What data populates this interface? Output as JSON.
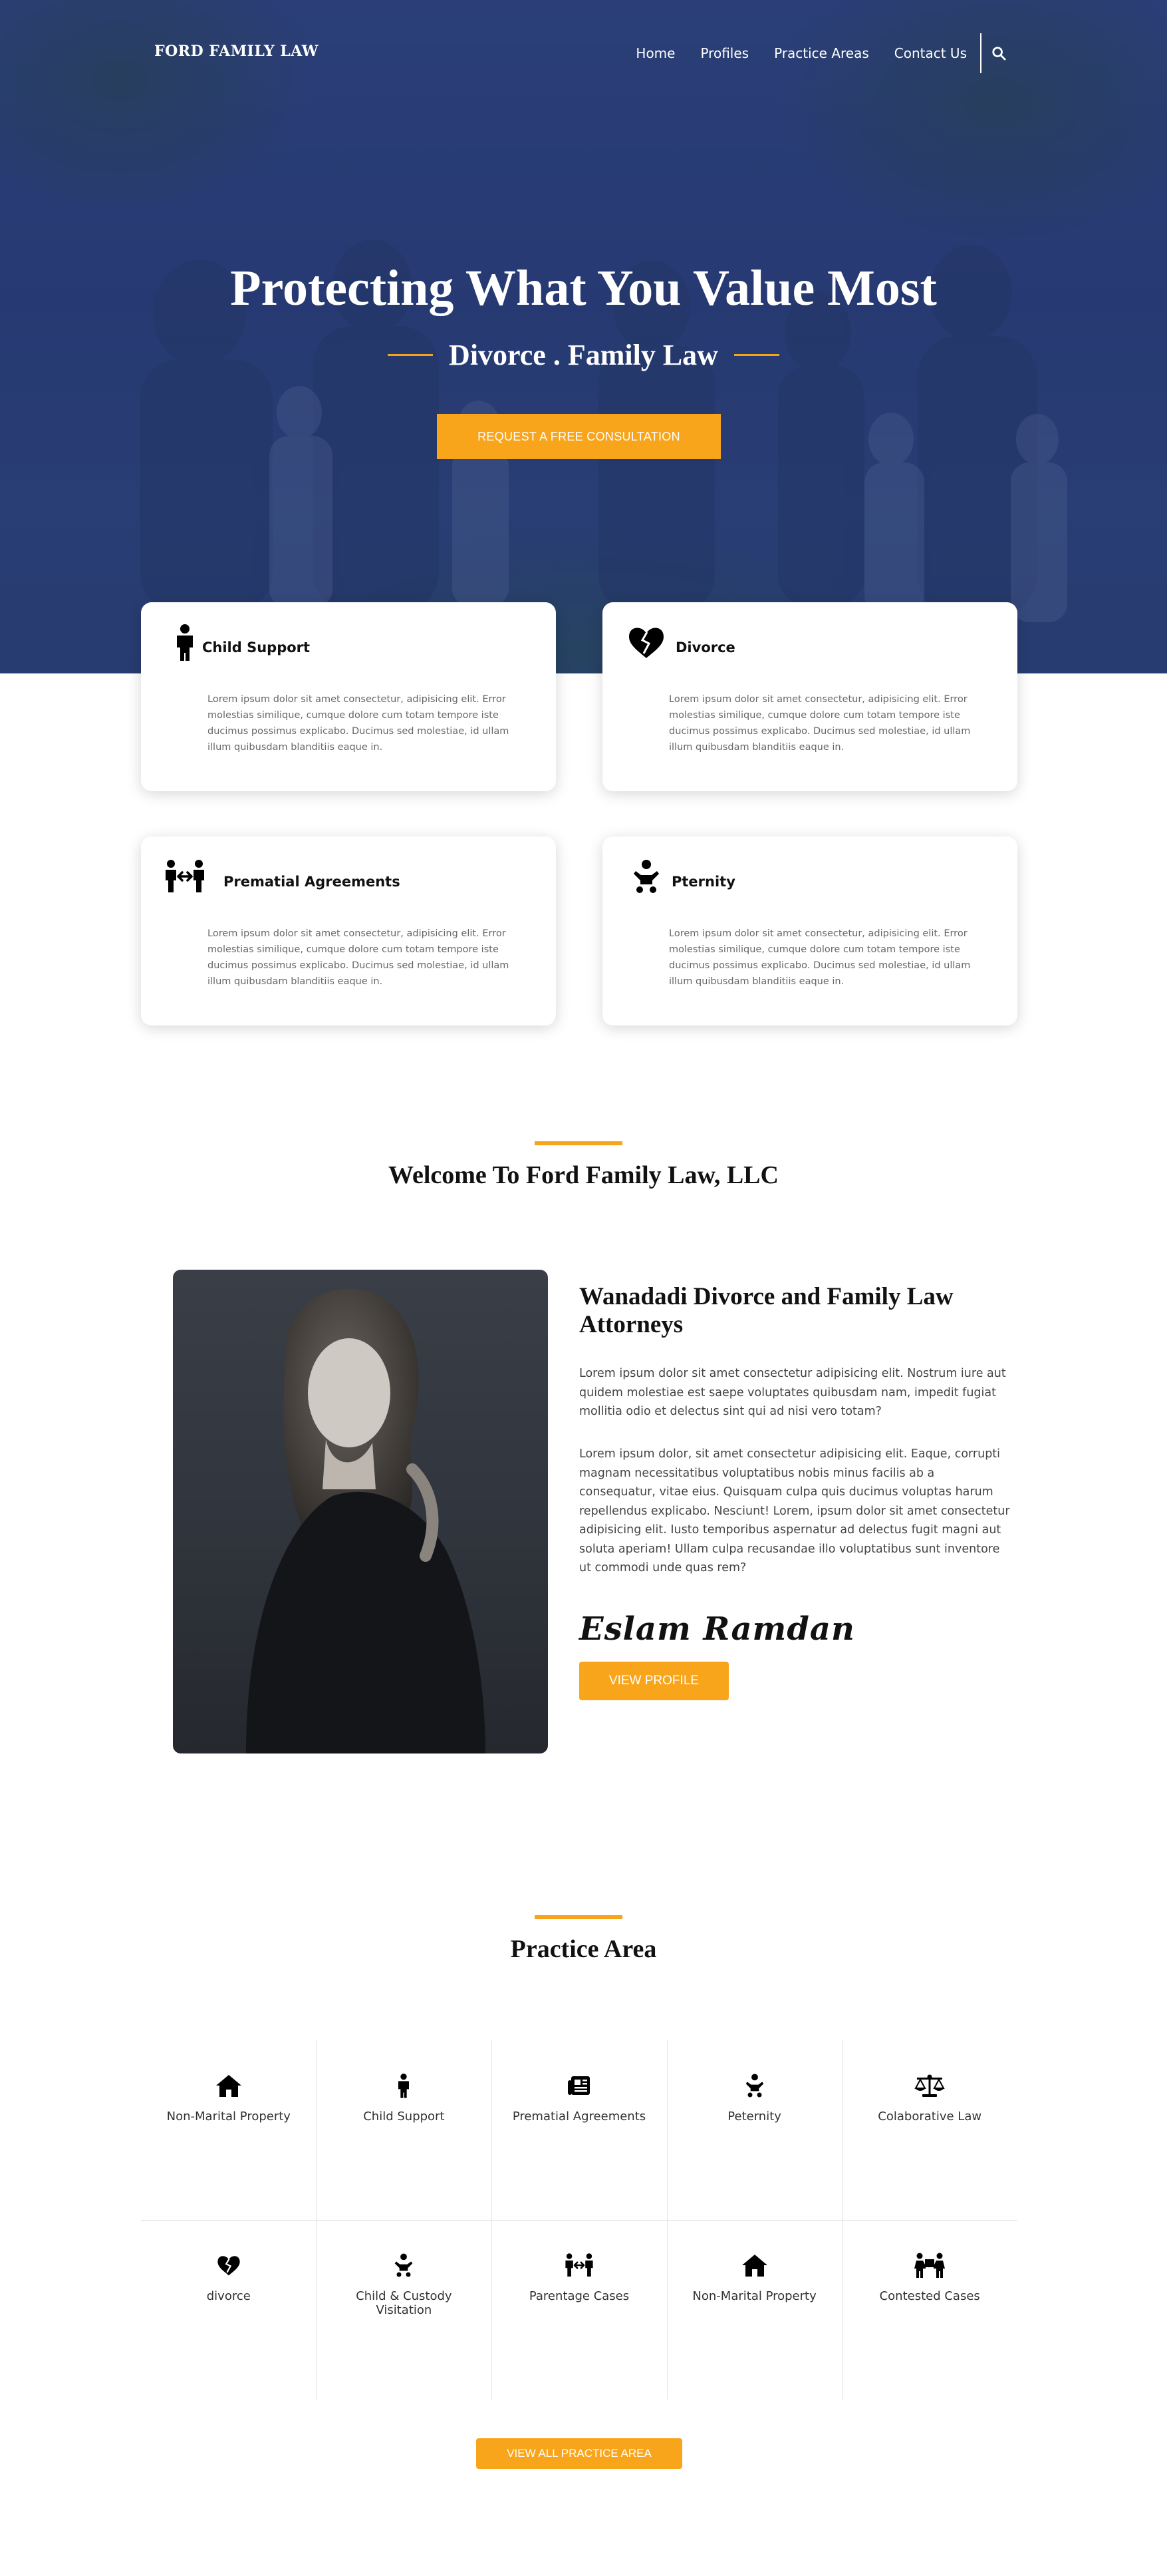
{
  "nav": {
    "brand": "FORD FAMILY LAW",
    "links": [
      "Home",
      "Profiles",
      "Practice Areas",
      "Contact Us"
    ],
    "search_icon": "search-icon"
  },
  "hero": {
    "title": "Protecting What You Value Most",
    "subtitle": "Divorce . Family Law",
    "cta": "REQUEST A FREE CONSULTATION"
  },
  "services": [
    {
      "title": "Child Support",
      "icon": "child-icon",
      "text": "Lorem ipsum dolor sit amet consectetur, adipisicing elit. Error molestias similique, cumque dolore cum totam tempore iste ducimus possimus explicabo. Ducimus sed molestiae, id ullam illum quibusdam blanditiis eaque in."
    },
    {
      "title": "Divorce",
      "icon": "broken-heart-icon",
      "text": "Lorem ipsum dolor sit amet consectetur, adipisicing elit. Error molestias similique, cumque dolore cum totam tempore iste ducimus possimus explicabo. Ducimus sed molestiae, id ullam illum quibusdam blanditiis eaque in."
    },
    {
      "title": "Prematial Agreements",
      "icon": "people-arrows-icon",
      "text": "Lorem ipsum dolor sit amet consectetur, adipisicing elit. Error molestias similique, cumque dolore cum totam tempore iste ducimus possimus explicabo. Ducimus sed molestiae, id ullam illum quibusdam blanditiis eaque in."
    },
    {
      "title": "Pternity",
      "icon": "baby-icon",
      "text": "Lorem ipsum dolor sit amet consectetur, adipisicing elit. Error molestias similique, cumque dolore cum totam tempore iste ducimus possimus explicabo. Ducimus sed molestiae, id ullam illum quibusdam blanditiis eaque in."
    }
  ],
  "welcome": {
    "heading": "Welcome To Ford Family Law, LLC",
    "title": "Wanadadi Divorce and Family Law Attorneys",
    "p1": "Lorem ipsum dolor sit amet consectetur adipisicing elit. Nostrum iure aut quidem molestiae est saepe voluptates quibusdam nam, impedit fugiat mollitia odio et delectus sint qui ad nisi vero totam?",
    "p2": "Lorem ipsum dolor, sit amet consectetur adipisicing elit. Eaque, corrupti magnam necessitatibus voluptatibus nobis minus facilis ab a consequatur, vitae eius. Quisquam culpa quis ducimus voluptas harum repellendus explicabo. Nesciunt! Lorem, ipsum dolor sit amet consectetur adipisicing elit. Iusto temporibus aspernatur ad delectus fugit magni aut soluta aperiam! Ullam culpa recusandae illo voluptatibus sunt inventore ut commodi unde quas rem?",
    "signature": "Eslam Ramdan",
    "button": "VIEW PROFILE"
  },
  "practice": {
    "heading": "Practice Area",
    "items": [
      {
        "label": "Non-Marital Property",
        "icon": "home-icon"
      },
      {
        "label": "Child Support",
        "icon": "child-icon"
      },
      {
        "label": "Prematial Agreements",
        "icon": "newspaper-icon"
      },
      {
        "label": "Peternity",
        "icon": "baby-icon"
      },
      {
        "label": "Colaborative Law",
        "icon": "balance-scale-icon"
      },
      {
        "label": "divorce",
        "icon": "broken-heart-icon"
      },
      {
        "label": "Child & Custody Visitation",
        "icon": "baby-icon"
      },
      {
        "label": "Parentage Cases",
        "icon": "people-arrows-icon"
      },
      {
        "label": "Non-Marital Property",
        "icon": "home-icon"
      },
      {
        "label": "Contested Cases",
        "icon": "people-carry-icon"
      }
    ],
    "button": "VIEW ALL PRACTICE AREA"
  },
  "colors": {
    "accent": "#f9a51c",
    "hero_overlay": "#223470"
  }
}
